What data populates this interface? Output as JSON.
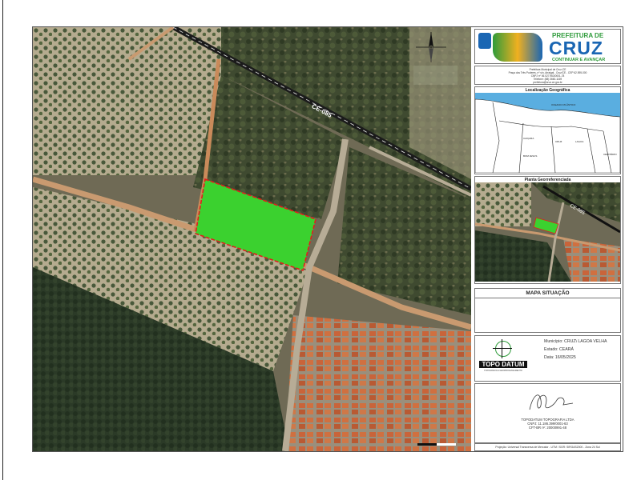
{
  "header": {
    "prefeitura_label": "PREFEITURA DE",
    "city_name": "CRUZ",
    "slogan": "CONTINUAR E AVANÇAR",
    "address_lines": [
      "Prefeitura Municipal de Cruz-CE",
      "Praça dos Três Poderes, nº s/n, Arraigal - Cruz/CE - CEP 62.595-000",
      "CNPJ nº 06.027.963/0001-78",
      "Telefone: (88) 3660-1169",
      "prefeitura@cruz.ce.gov.br"
    ]
  },
  "localizacao": {
    "title": "Localização Geográfica",
    "region_labels": [
      "OCEANO ATLÂNTICO",
      "BOM JESUS",
      "CAIÇARA",
      "LAGOA",
      "CRUZ",
      "CEMITÉRIO",
      "PRAIA DO PREÁ"
    ]
  },
  "planta": {
    "title": "Planta Georreferenciada",
    "road_label": "CE-085"
  },
  "mapa_situacao": {
    "title": "MAPA SITUAÇÃO"
  },
  "details": {
    "municipio": "Município: CRUZ\\ LAGOA VELHA",
    "estado": "Estado: CEARÁ",
    "data": "Data: 16/05/2025",
    "company_logo_text": "TOPO DATUM",
    "company_logo_sub": "TOPOGRAFIA & GEOPROCESSAMENTO"
  },
  "signature": {
    "company": "TOPODATUM TOPOGRAFIA LTDA",
    "cnpj": "CNPJ: 11.186.399/0001-63",
    "crea": "CFT-BR nº: 20000991-48"
  },
  "footer": {
    "projection": "Projeção: Universal Transversa de Mercator - UTM / SGR: SIRGAS2000 - Zona 24 Sul"
  },
  "map": {
    "road_label": "CE-085",
    "parcel_fill": "#3bd12f",
    "parcel_border": "#e0201c"
  },
  "colors": {
    "header_green": "#2e9b3a",
    "header_blue": "#1a66b3",
    "ocean": "#5aaee0"
  }
}
